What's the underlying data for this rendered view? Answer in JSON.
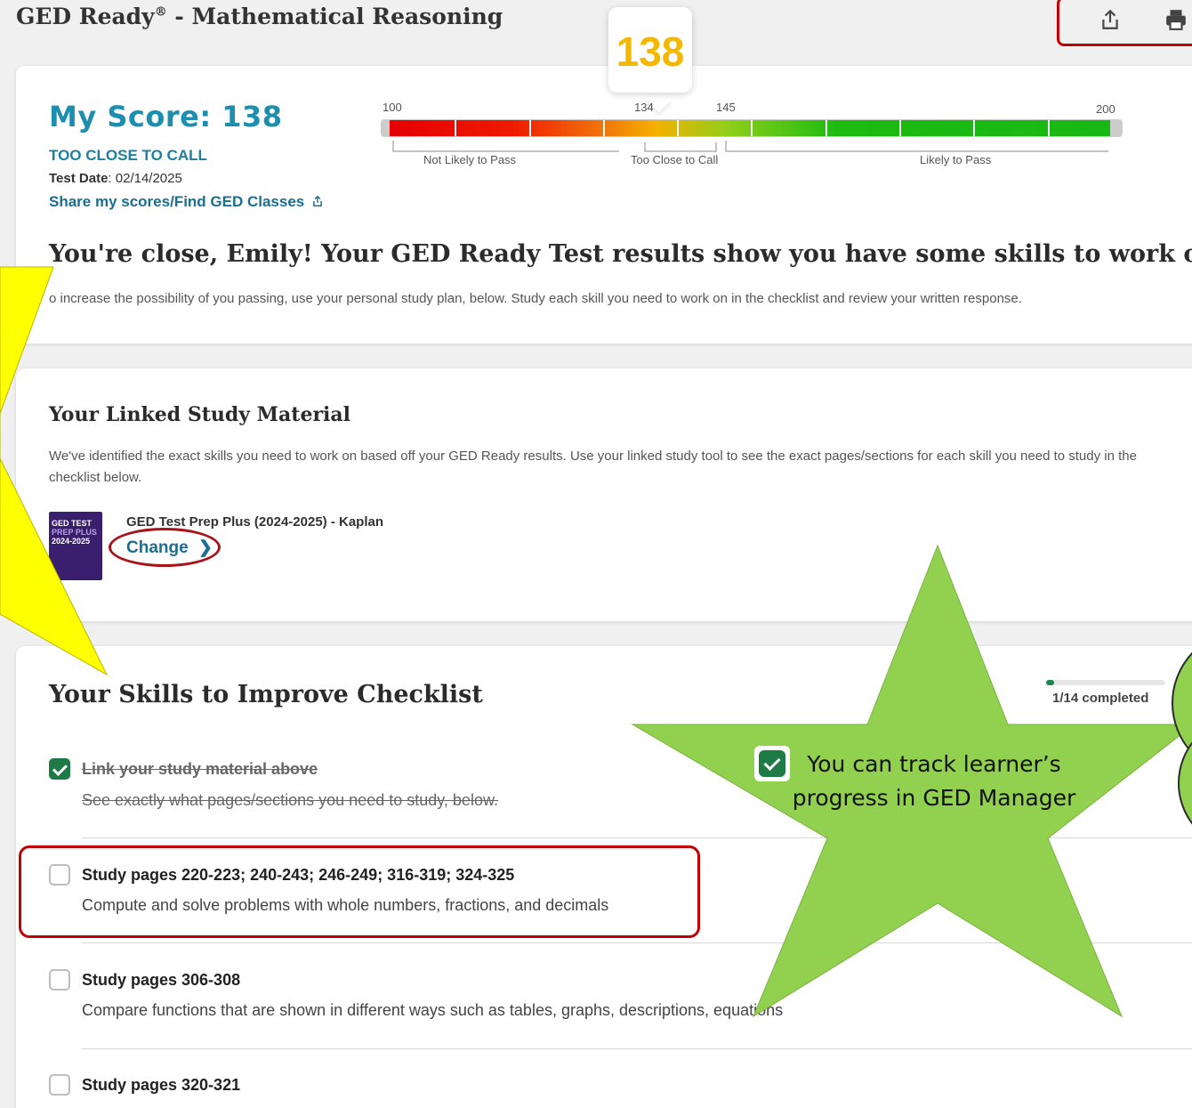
{
  "header": {
    "title": "GED Ready",
    "title_mark": "®",
    "title_suffix": " - Mathematical Reasoning",
    "share_icon": "share-icon",
    "print_icon": "print-icon"
  },
  "score_bubble": "138",
  "score": {
    "label": "My Score: 138",
    "status": "TOO CLOSE TO CALL",
    "test_date_label": "Test Date",
    "test_date": ": 02/14/2025",
    "share_link": "Share my scores/Find GED Classes"
  },
  "scale": {
    "min": "100",
    "mark_low": "134",
    "mark_high": "145",
    "max": "200",
    "zones": [
      "Not Likely to Pass",
      "Too Close to Call",
      "Likely to Pass"
    ]
  },
  "result": {
    "headline": "You're close, Emily! Your GED Ready Test results show you have some skills to work on.",
    "subtext": "o increase the possibility of you passing, use your personal study plan, below. Study each skill you need to work on in the checklist and review your written response."
  },
  "linked": {
    "title": "Your Linked Study Material",
    "description": "We've identified the exact skills you need to work on based off your GED Ready results. Use your linked study tool to see the exact pages/sections for each skill you need to study in the checklist below.",
    "book_cover_lines": [
      "GED TEST",
      "PREP PLUS",
      "2024-2025"
    ],
    "book_title": "GED Test Prep Plus (2024-2025) - Kaplan",
    "change_label": "Change"
  },
  "checklist": {
    "title": "Your Skills to Improve Checklist",
    "progress_fraction": 0.07,
    "progress_text": "1/14 completed",
    "items": [
      {
        "title": "Link your study material above",
        "desc": "See exactly what pages/sections you need to study, below.",
        "checked": true
      },
      {
        "title": "Study pages 220-223; 240-243; 246-249; 316-319; 324-325",
        "desc": "Compute and solve problems with whole numbers, fractions, and decimals",
        "checked": false
      },
      {
        "title": "Study pages 306-308",
        "desc": "Compare functions that are shown in different ways such as tables, graphs, descriptions, equations",
        "checked": false
      },
      {
        "title": "Study pages 320-321",
        "desc": "",
        "checked": false
      }
    ]
  },
  "callout": {
    "text_line1": "You can track learner’s",
    "text_line2": "progress in GED Manager",
    "star_color": "#92d050",
    "arrow_color": "#ffff00",
    "highlight_color": "#c00000"
  }
}
